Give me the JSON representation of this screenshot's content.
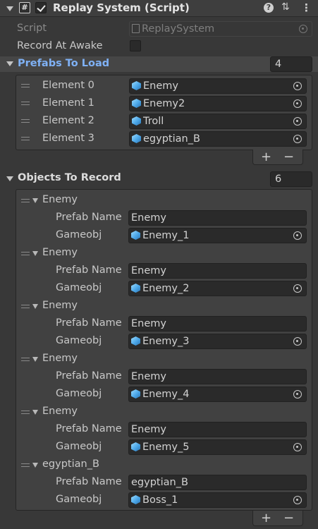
{
  "component": {
    "title": "Replay System (Script)",
    "enabled": true
  },
  "script": {
    "label": "Script",
    "value": "ReplaySystem"
  },
  "record_at_awake": {
    "label": "Record At Awake",
    "checked": false
  },
  "prefabs": {
    "label": "Prefabs To Load",
    "count": "4",
    "elements": [
      {
        "label": "Element 0",
        "value": "Enemy"
      },
      {
        "label": "Element 1",
        "value": "Enemy2"
      },
      {
        "label": "Element 2",
        "value": "Troll"
      },
      {
        "label": "Element 3",
        "value": "egyptian_B"
      }
    ]
  },
  "objects": {
    "label": "Objects To Record",
    "count": "6",
    "prefab_name_label": "Prefab Name",
    "gameobj_label": "Gameobj",
    "items": [
      {
        "title": "Enemy",
        "prefab_name": "Enemy",
        "gameobj": "Enemy_1"
      },
      {
        "title": "Enemy",
        "prefab_name": "Enemy",
        "gameobj": "Enemy_2"
      },
      {
        "title": "Enemy",
        "prefab_name": "Enemy",
        "gameobj": "Enemy_3"
      },
      {
        "title": "Enemy",
        "prefab_name": "Enemy",
        "gameobj": "Enemy_4"
      },
      {
        "title": "Enemy",
        "prefab_name": "Enemy",
        "gameobj": "Enemy_5"
      },
      {
        "title": "egyptian_B",
        "prefab_name": "egyptian_B",
        "gameobj": "Boss_1"
      }
    ]
  },
  "icons": {
    "plus": "+",
    "minus": "−",
    "help": "?",
    "more": "⋮",
    "presets": "⇅"
  }
}
